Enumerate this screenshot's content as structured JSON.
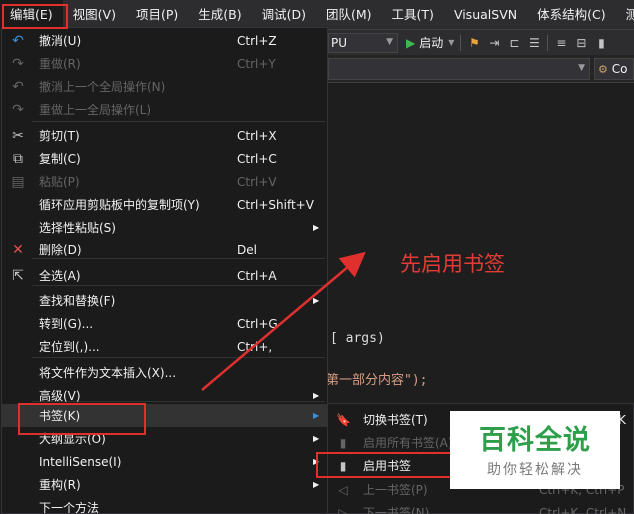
{
  "menubar": [
    {
      "label": "编辑(E)",
      "active": true
    },
    {
      "label": "视图(V)"
    },
    {
      "label": "项目(P)"
    },
    {
      "label": "生成(B)"
    },
    {
      "label": "调试(D)"
    },
    {
      "label": "团队(M)"
    },
    {
      "label": "工具(T)"
    },
    {
      "label": "VisualSVN"
    },
    {
      "label": "体系结构(C)"
    },
    {
      "label": "测试(S"
    }
  ],
  "toolbar": {
    "platform": "PU",
    "start_label": "启动",
    "nav_right": "Co"
  },
  "code": {
    "line1": "args)",
    "line2": "第一部分内容\");"
  },
  "edit_menu": [
    {
      "label": "撤消(U)",
      "shortcut": "Ctrl+Z",
      "icon": "undo-icon",
      "glyph": "↶",
      "disabled": false
    },
    {
      "label": "重做(R)",
      "shortcut": "Ctrl+Y",
      "icon": "redo-icon",
      "glyph": "↷",
      "disabled": true
    },
    {
      "label": "撤消上一个全局操作(N)",
      "shortcut": "",
      "icon": "global-undo-icon",
      "glyph": "↶",
      "disabled": true
    },
    {
      "label": "重做上一全局操作(L)",
      "shortcut": "",
      "icon": "global-redo-icon",
      "glyph": "↷",
      "disabled": true
    },
    {
      "label": "剪切(T)",
      "shortcut": "Ctrl+X",
      "icon": "cut-icon",
      "glyph": "✂",
      "disabled": false
    },
    {
      "label": "复制(C)",
      "shortcut": "Ctrl+C",
      "icon": "copy-icon",
      "glyph": "⧉",
      "disabled": false
    },
    {
      "label": "粘贴(P)",
      "shortcut": "Ctrl+V",
      "icon": "paste-icon",
      "glyph": "▤",
      "disabled": true
    },
    {
      "label": "循环应用剪贴板中的复制项(Y)",
      "shortcut": "Ctrl+Shift+V",
      "icon": "",
      "glyph": "",
      "disabled": false
    },
    {
      "label": "选择性粘贴(S)",
      "shortcut": "",
      "icon": "",
      "glyph": "",
      "disabled": false,
      "submenu": true
    },
    {
      "label": "删除(D)",
      "shortcut": "Del",
      "icon": "delete-icon",
      "glyph": "✕",
      "disabled": false
    },
    {
      "label": "全选(A)",
      "shortcut": "Ctrl+A",
      "icon": "select-all-icon",
      "glyph": "⇱",
      "disabled": false
    },
    {
      "label": "查找和替换(F)",
      "shortcut": "",
      "icon": "",
      "glyph": "",
      "disabled": false,
      "submenu": true
    },
    {
      "label": "转到(G)...",
      "shortcut": "Ctrl+G",
      "icon": "",
      "glyph": "",
      "disabled": false
    },
    {
      "label": "定位到(,)...",
      "shortcut": "Ctrl+,",
      "icon": "",
      "glyph": "",
      "disabled": false
    },
    {
      "label": "将文件作为文本插入(X)...",
      "shortcut": "",
      "icon": "",
      "glyph": "",
      "disabled": false
    },
    {
      "label": "高级(V)",
      "shortcut": "",
      "icon": "",
      "glyph": "",
      "disabled": false,
      "submenu": true
    },
    {
      "label": "书签(K)",
      "shortcut": "",
      "icon": "",
      "glyph": "",
      "disabled": false,
      "submenu": true,
      "highlight": true
    },
    {
      "label": "大纲显示(O)",
      "shortcut": "",
      "icon": "",
      "glyph": "",
      "disabled": false,
      "submenu": true
    },
    {
      "label": "IntelliSense(I)",
      "shortcut": "",
      "icon": "",
      "glyph": "",
      "disabled": false,
      "submenu": true
    },
    {
      "label": "重构(R)",
      "shortcut": "",
      "icon": "",
      "glyph": "",
      "disabled": false,
      "submenu": true
    },
    {
      "label": "下一个方法",
      "shortcut": "",
      "icon": "",
      "glyph": "",
      "disabled": false
    }
  ],
  "bookmark_menu": [
    {
      "label": "切换书签(T)",
      "shortcut": "K",
      "icon": "bookmark-icon",
      "glyph": "🔖",
      "disabled": false
    },
    {
      "label": "启用所有书签(A)",
      "shortcut": "",
      "icon": "bookmark-all-icon",
      "glyph": "▮",
      "disabled": true
    },
    {
      "label": "启用书签",
      "shortcut": "",
      "icon": "bookmark-enable-icon",
      "glyph": "▮",
      "disabled": false
    },
    {
      "label": "上一书签(P)",
      "shortcut": "Ctrl+K, Ctrl+P",
      "icon": "prev-bookmark-icon",
      "glyph": "◁",
      "disabled": true
    },
    {
      "label": "下一书签(N)",
      "shortcut": "Ctrl+K, Ctrl+N",
      "icon": "next-bookmark-icon",
      "glyph": "▷",
      "disabled": true
    }
  ],
  "annotation": "先启用书签",
  "watermark": {
    "title": "百科全说",
    "subtitle": "助你轻松解决"
  },
  "colors": {
    "accent_red": "#e0302e",
    "bg": "#1b1b1c",
    "brand_green": "#2d9f4b"
  }
}
